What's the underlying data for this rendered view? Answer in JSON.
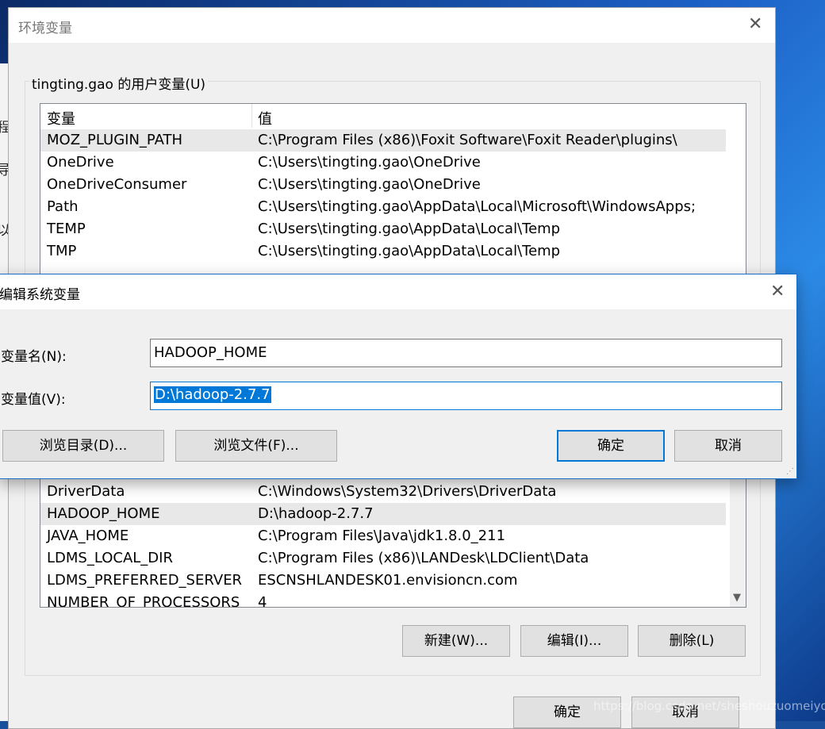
{
  "env_window": {
    "title": "环境变量",
    "user_group_label": "tingting.gao 的用户变量(U)",
    "user_vars": {
      "headers": [
        "变量",
        "值"
      ],
      "rows": [
        {
          "name": "MOZ_PLUGIN_PATH",
          "value": "C:\\Program Files (x86)\\Foxit Software\\Foxit Reader\\plugins\\"
        },
        {
          "name": "OneDrive",
          "value": "C:\\Users\\tingting.gao\\OneDrive"
        },
        {
          "name": "OneDriveConsumer",
          "value": "C:\\Users\\tingting.gao\\OneDrive"
        },
        {
          "name": "Path",
          "value": "C:\\Users\\tingting.gao\\AppData\\Local\\Microsoft\\WindowsApps;"
        },
        {
          "name": "TEMP",
          "value": "C:\\Users\\tingting.gao\\AppData\\Local\\Temp"
        },
        {
          "name": "TMP",
          "value": "C:\\Users\\tingting.gao\\AppData\\Local\\Temp"
        }
      ]
    },
    "system_vars": {
      "rows": [
        {
          "name": "DriverData",
          "value": "C:\\Windows\\System32\\Drivers\\DriverData"
        },
        {
          "name": "HADOOP_HOME",
          "value": "D:\\hadoop-2.7.7"
        },
        {
          "name": "JAVA_HOME",
          "value": "C:\\Program Files\\Java\\jdk1.8.0_211"
        },
        {
          "name": "LDMS_LOCAL_DIR",
          "value": "C:\\Program Files (x86)\\LANDesk\\LDClient\\Data"
        },
        {
          "name": "LDMS_PREFERRED_SERVER",
          "value": "ESCNSHLANDESK01.envisioncn.com"
        },
        {
          "name": "NUMBER_OF_PROCESSORS",
          "value": "4"
        }
      ]
    },
    "buttons": {
      "new": "新建(W)...",
      "edit": "编辑(I)...",
      "delete": "删除(L)",
      "ok": "确定",
      "cancel": "取消"
    }
  },
  "edit_dialog": {
    "title": "编辑系统变量",
    "name_label": "变量名(N):",
    "name_value": "HADOOP_HOME",
    "value_label": "变量值(V):",
    "value_value": "D:\\hadoop-2.7.7",
    "browse_dir": "浏览目录(D)...",
    "browse_file": "浏览文件(F)...",
    "ok": "确定",
    "cancel": "取消"
  },
  "background_fragments": [
    "程",
    "导",
    "以"
  ],
  "watermark": "https://blog.csdn.net/sheshouzuomeiyou"
}
